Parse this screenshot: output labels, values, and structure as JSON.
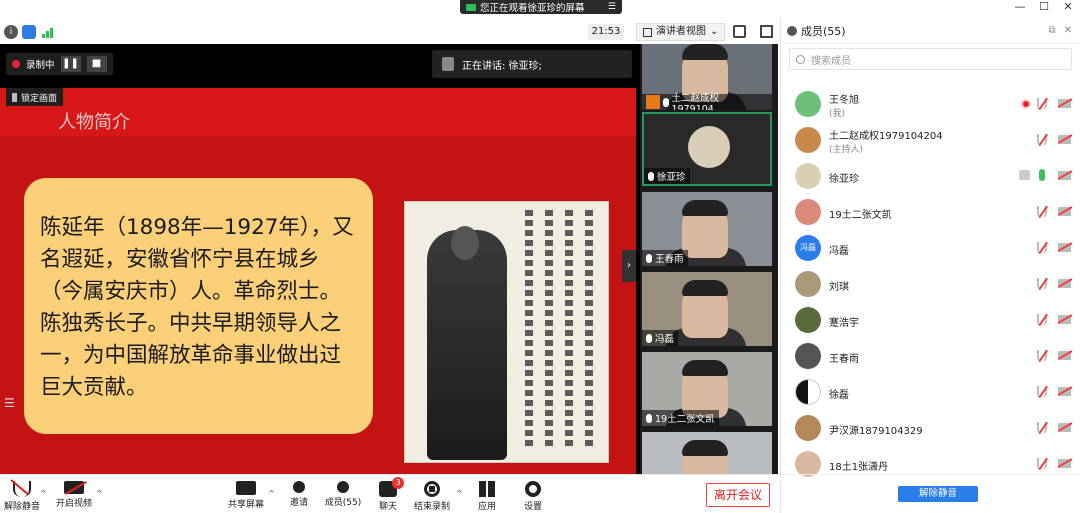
{
  "share_banner": {
    "text": "您正在观看徐亚珍的屏幕",
    "menu": "☰"
  },
  "window_controls": {
    "minimize": "—",
    "maximize": "☐",
    "close": "✕"
  },
  "top_bar": {
    "info": "i",
    "clock": "21:53",
    "view_mode": "演讲者视图",
    "view_caret": "⌄"
  },
  "recording": {
    "label": "录制中",
    "pause": "❚❚",
    "stop": "■",
    "lock_label": "锁定画面"
  },
  "speaking": {
    "label": "正在讲话: 徐亚珍;"
  },
  "slide": {
    "title": "人物简介",
    "body": "陈延年（1898年—1927年），又名遐延，安徽省怀宁县在城乡（今属安庆市）人。革命烈士。陈独秀长子。中共早期领导人之一，为中国解放革命事业做出过巨大贡献。"
  },
  "side_icons": {
    "list": "☰",
    "collapse": "›"
  },
  "video_tiles": [
    {
      "name": "土二赵成权1979104..."
    },
    {
      "name": "徐亚珍"
    },
    {
      "name": "王春雨"
    },
    {
      "name": "冯磊"
    },
    {
      "name": "19土二张文凯"
    },
    {
      "name": ""
    }
  ],
  "toolbar": {
    "unmute": "解除静音",
    "start_video": "开启视频",
    "share_screen": "共享屏幕",
    "invite": "邀请",
    "members": "成员(55)",
    "chat": "聊天",
    "chat_badge": "3",
    "end_record": "结束录制",
    "apps": "应用",
    "settings": "设置",
    "leave": "离开会议",
    "caret": "^"
  },
  "panel": {
    "title": "成员(55)",
    "search_placeholder": "搜索成员",
    "unmute_all": "解除静音",
    "members": [
      {
        "name": "王冬旭",
        "role": "(我)",
        "avatar_color": "#6fbf7a",
        "avatar_text": ""
      },
      {
        "name": "土二赵成权1979104204",
        "role": "(主持人)",
        "avatar_color": "#c78a4a",
        "avatar_text": ""
      },
      {
        "name": "徐亚珍",
        "role": "",
        "avatar_color": "#d9cdb2",
        "avatar_text": ""
      },
      {
        "name": "19土二张文凯",
        "role": "",
        "avatar_color": "#d98a7a",
        "avatar_text": ""
      },
      {
        "name": "冯磊",
        "role": "",
        "avatar_color": "#2b7de9",
        "avatar_text": "冯磊"
      },
      {
        "name": "刘琪",
        "role": "",
        "avatar_color": "#a99a7a",
        "avatar_text": ""
      },
      {
        "name": "蹇浩宇",
        "role": "",
        "avatar_color": "#5a6a3a",
        "avatar_text": ""
      },
      {
        "name": "王春雨",
        "role": "",
        "avatar_color": "#555555",
        "avatar_text": ""
      },
      {
        "name": "徐磊",
        "role": "",
        "avatar_color": "#111111",
        "avatar_text": ""
      },
      {
        "name": "尹汉源1879104329",
        "role": "",
        "avatar_color": "#b58a5a",
        "avatar_text": ""
      },
      {
        "name": "18土1张潇丹",
        "role": "",
        "avatar_color": "#d9b8a0",
        "avatar_text": ""
      }
    ]
  }
}
